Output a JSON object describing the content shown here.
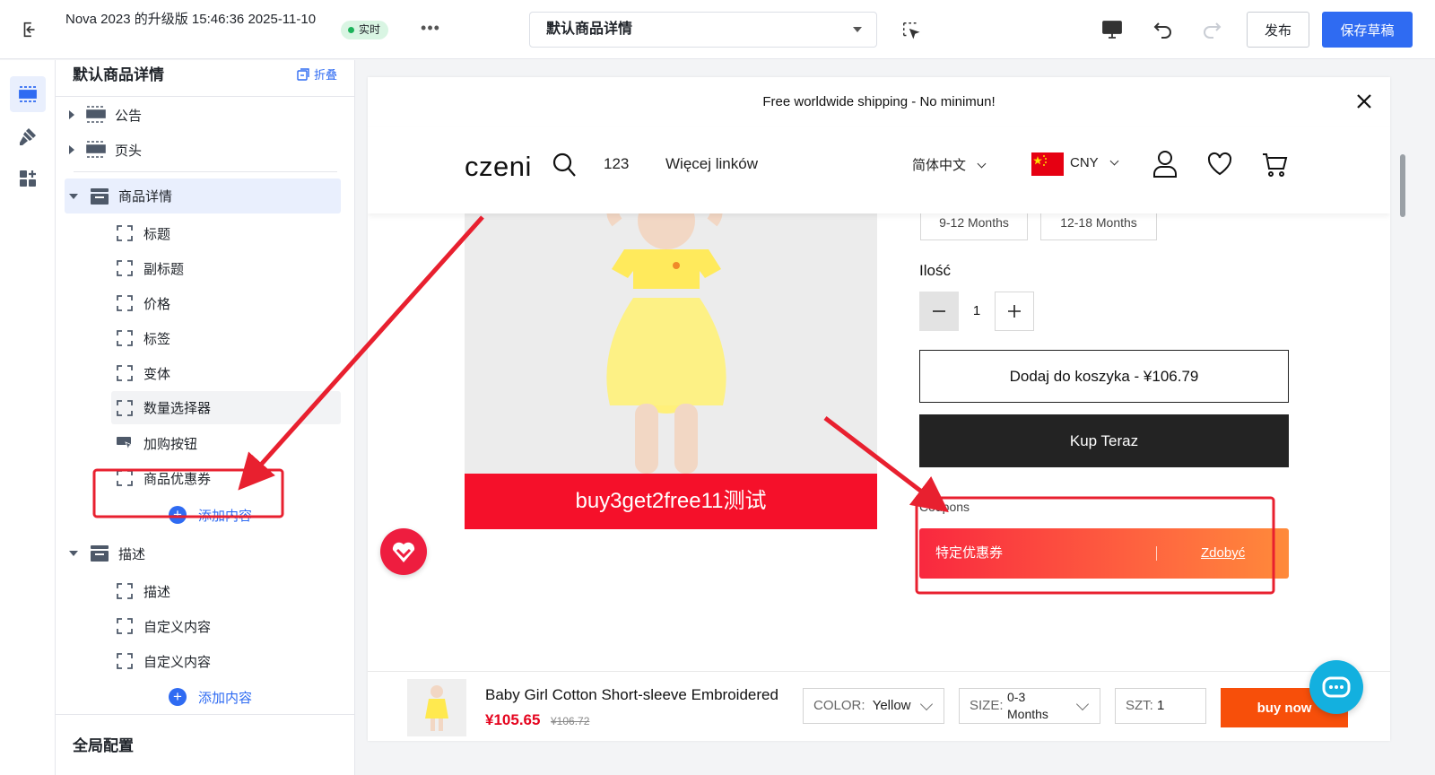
{
  "topbar": {
    "doc_title": "Nova 2023 的升级版 15:46:36 2025-11-10",
    "live_label": "实时",
    "more_label": "•••",
    "page_select_value": "默认商品详情",
    "publish_label": "发布",
    "save_label": "保存草稿"
  },
  "panel": {
    "title": "默认商品详情",
    "collapse_label": "折叠",
    "sections": [
      {
        "label": "公告"
      },
      {
        "label": "页头"
      },
      {
        "label": "商品详情"
      },
      {
        "label": "描述"
      }
    ],
    "product_blocks": [
      "标题",
      "副标题",
      "价格",
      "标签",
      "变体",
      "数量选择器",
      "加购按钮",
      "商品优惠券"
    ],
    "description_blocks": [
      "描述",
      "自定义内容",
      "自定义内容"
    ],
    "add_content_label": "添加内容",
    "global_title": "全局配置"
  },
  "preview": {
    "announcement": "Free worldwide shipping - No minimun!",
    "logo": "czeni",
    "nav": [
      "123",
      "Więcej linków"
    ],
    "language": "简体中文",
    "currency": "CNY",
    "promo_text": "buy3get2free11测试",
    "variants": [
      "9-12 Months",
      "12-18 Months"
    ],
    "quantity_label": "Ilość",
    "quantity_value": "1",
    "add_to_cart_label": "Dodaj do koszyka  -  ¥106.79",
    "buy_now_label": "Kup Teraz",
    "coupons_label": "Coupons",
    "coupon_name": "特定优惠券",
    "coupon_action": "Zdobyć",
    "sticky": {
      "product_name": "Baby Girl Cotton Short-sleeve Embroidered",
      "price": "¥105.65",
      "original_price": "¥106.72",
      "color_label": "COLOR:",
      "color_value": "Yellow",
      "size_label": "SIZE:",
      "size_value_1": "0-3",
      "size_value_2": "Months",
      "qty_label": "SZT:",
      "qty_value": "1",
      "buy_label": "buy now"
    }
  },
  "colors": {
    "accent": "#2f6bf2",
    "promo_red": "#f5102a",
    "annotation_red": "#e8202f",
    "coupon_orange": "#ff8a3a"
  }
}
